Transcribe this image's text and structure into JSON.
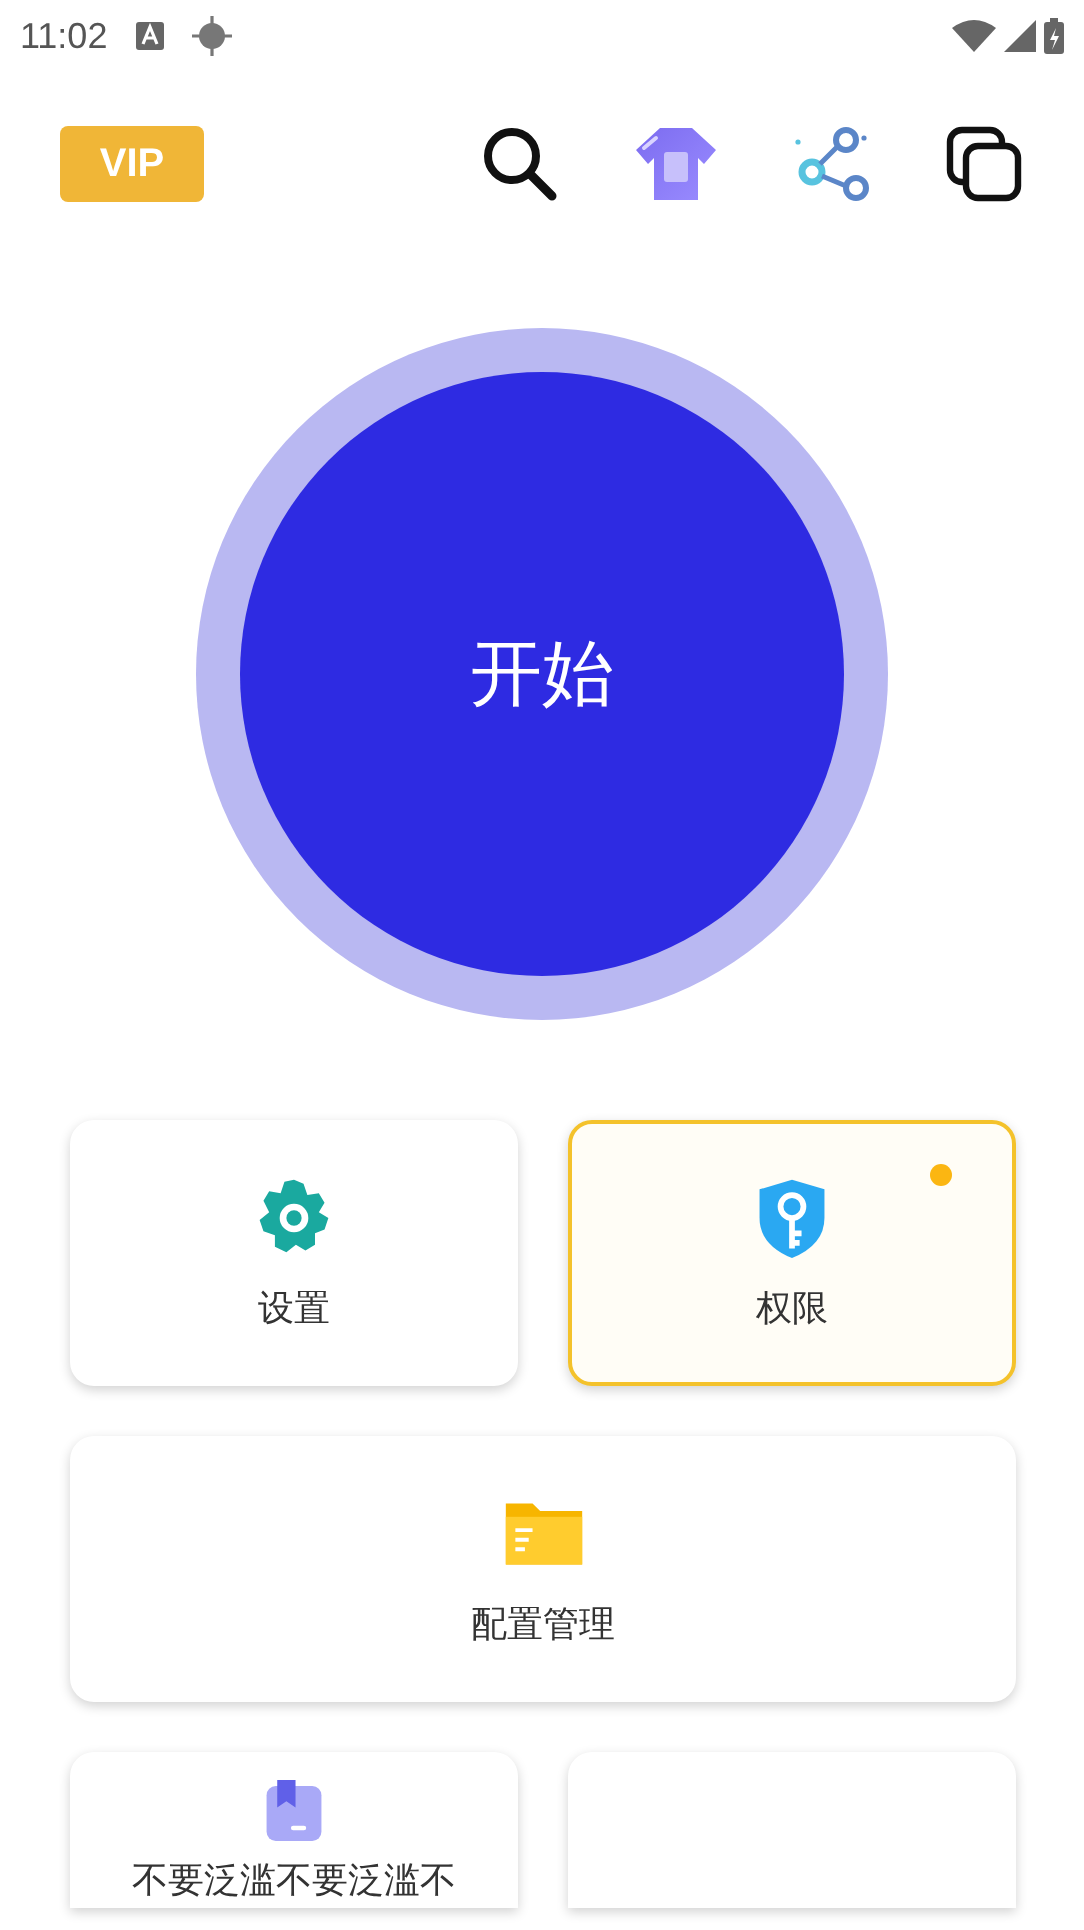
{
  "status_bar": {
    "time": "11:02"
  },
  "header": {
    "vip_label": "VIP"
  },
  "start_button": {
    "label": "开始"
  },
  "tiles": [
    {
      "label": "设置",
      "kind": "gear",
      "wide": false,
      "highlighted": false,
      "notice": false
    },
    {
      "label": "权限",
      "kind": "shield",
      "wide": false,
      "highlighted": true,
      "notice": true
    },
    {
      "label": "配置管理",
      "kind": "folder",
      "wide": true,
      "highlighted": false,
      "notice": false
    },
    {
      "label": "不要泛滥不要泛滥不",
      "kind": "bookmark",
      "wide": false,
      "highlighted": false,
      "notice": false
    },
    {
      "wide": false,
      "highlighted": false,
      "notice": false
    }
  ]
}
